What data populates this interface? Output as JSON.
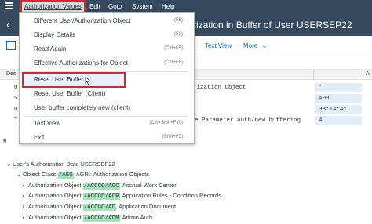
{
  "menubar": {
    "items": [
      "Authorization Values",
      "Edit",
      "Goto",
      "System",
      "Help"
    ]
  },
  "title": {
    "text": "rization in Buffer of User USERSEP22"
  },
  "toolbar": {
    "text_view_label": "Text View",
    "more_label": "More"
  },
  "table": {
    "header_left": "Des",
    "header_right": "A"
  },
  "rows": {
    "prefixes": [
      "U",
      "S",
      "D",
      "I"
    ],
    "texts": [
      "rization Object",
      "",
      "",
      "e Parameter auth/new buffering"
    ],
    "values": [
      "*",
      "400",
      "03:14:41",
      "4"
    ],
    "na_prefix": "N"
  },
  "tree": {
    "root_label": "User's Authorization Data USERSEP22",
    "object_class": {
      "label": "Object Class",
      "code": "/AGG",
      "desc": "AGRI: Authorization Objects"
    },
    "objects": [
      {
        "label": "Authorization Object",
        "code": "/ACCGO/ACC",
        "desc": "Accrual Work Center"
      },
      {
        "label": "Authorization Object",
        "code": "/ACCGO/ACR",
        "desc": "Application Rules - Condition Records"
      },
      {
        "label": "Authorization Object",
        "code": "/ACCGO/AD",
        "desc": "Application Document"
      },
      {
        "label": "Authorization Object",
        "code": "/ACCGO/ADM",
        "desc": "Admin Auth"
      }
    ]
  },
  "dropdown": {
    "items": [
      {
        "label": "Different User/Authorization Object",
        "shortcut": "(F5)"
      },
      {
        "label": "Display Details",
        "shortcut": "(F2)"
      },
      {
        "label": "Read Again",
        "shortcut": "(Ctrl+F5)"
      },
      {
        "label": "Effective Authorizations for Object",
        "shortcut": "(Ctrl+F8)"
      },
      {
        "label": "Reset User Buffer",
        "shortcut": ""
      },
      {
        "label": "Reset User Buffer (Client)",
        "shortcut": ""
      },
      {
        "label": "User buffer completely new (client)",
        "shortcut": ""
      },
      {
        "label": "Text View",
        "shortcut": "(Ctrl+Shift+F10)"
      },
      {
        "label": "Exit",
        "shortcut": "(Shift+F3)"
      }
    ]
  },
  "colors": {
    "shell": "#354a5f",
    "accent": "#0a6ed1",
    "highlight_red": "#d7262c",
    "code_highlight": "#9ee6b8"
  }
}
